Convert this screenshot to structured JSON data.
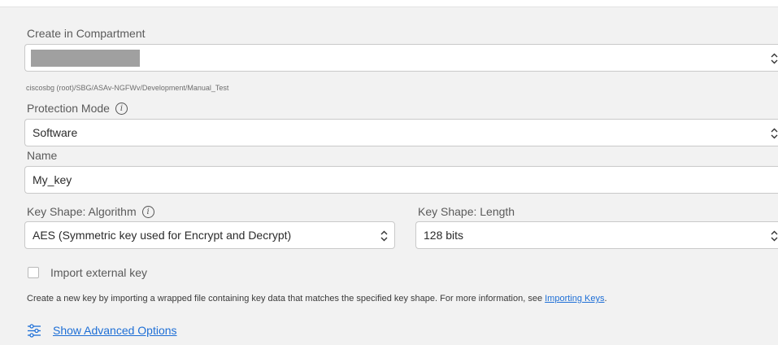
{
  "form": {
    "compartment": {
      "label": "Create in Compartment",
      "path": "ciscosbg (root)/SBG/ASAv-NGFWv/Development/Manual_Test"
    },
    "protection_mode": {
      "label": "Protection Mode",
      "value": "Software"
    },
    "name": {
      "label": "Name",
      "value": "My_key"
    },
    "algorithm": {
      "label": "Key Shape: Algorithm",
      "value": "AES (Symmetric key used for Encrypt and Decrypt)"
    },
    "length": {
      "label": "Key Shape: Length",
      "value": "128 bits"
    },
    "import_external": {
      "label": "Import external key",
      "checked": false
    },
    "help": {
      "text": "Create a new key by importing a wrapped file containing key data that matches the specified key shape. For more information, see ",
      "link": "Importing Keys",
      "suffix": "."
    },
    "advanced": {
      "label": "Show Advanced Options",
      "icon": "sliders-icon"
    }
  },
  "colors": {
    "panel_bg": "#f2f2f2",
    "link": "#1e6fd6",
    "redaction": "#a0a0a0"
  }
}
